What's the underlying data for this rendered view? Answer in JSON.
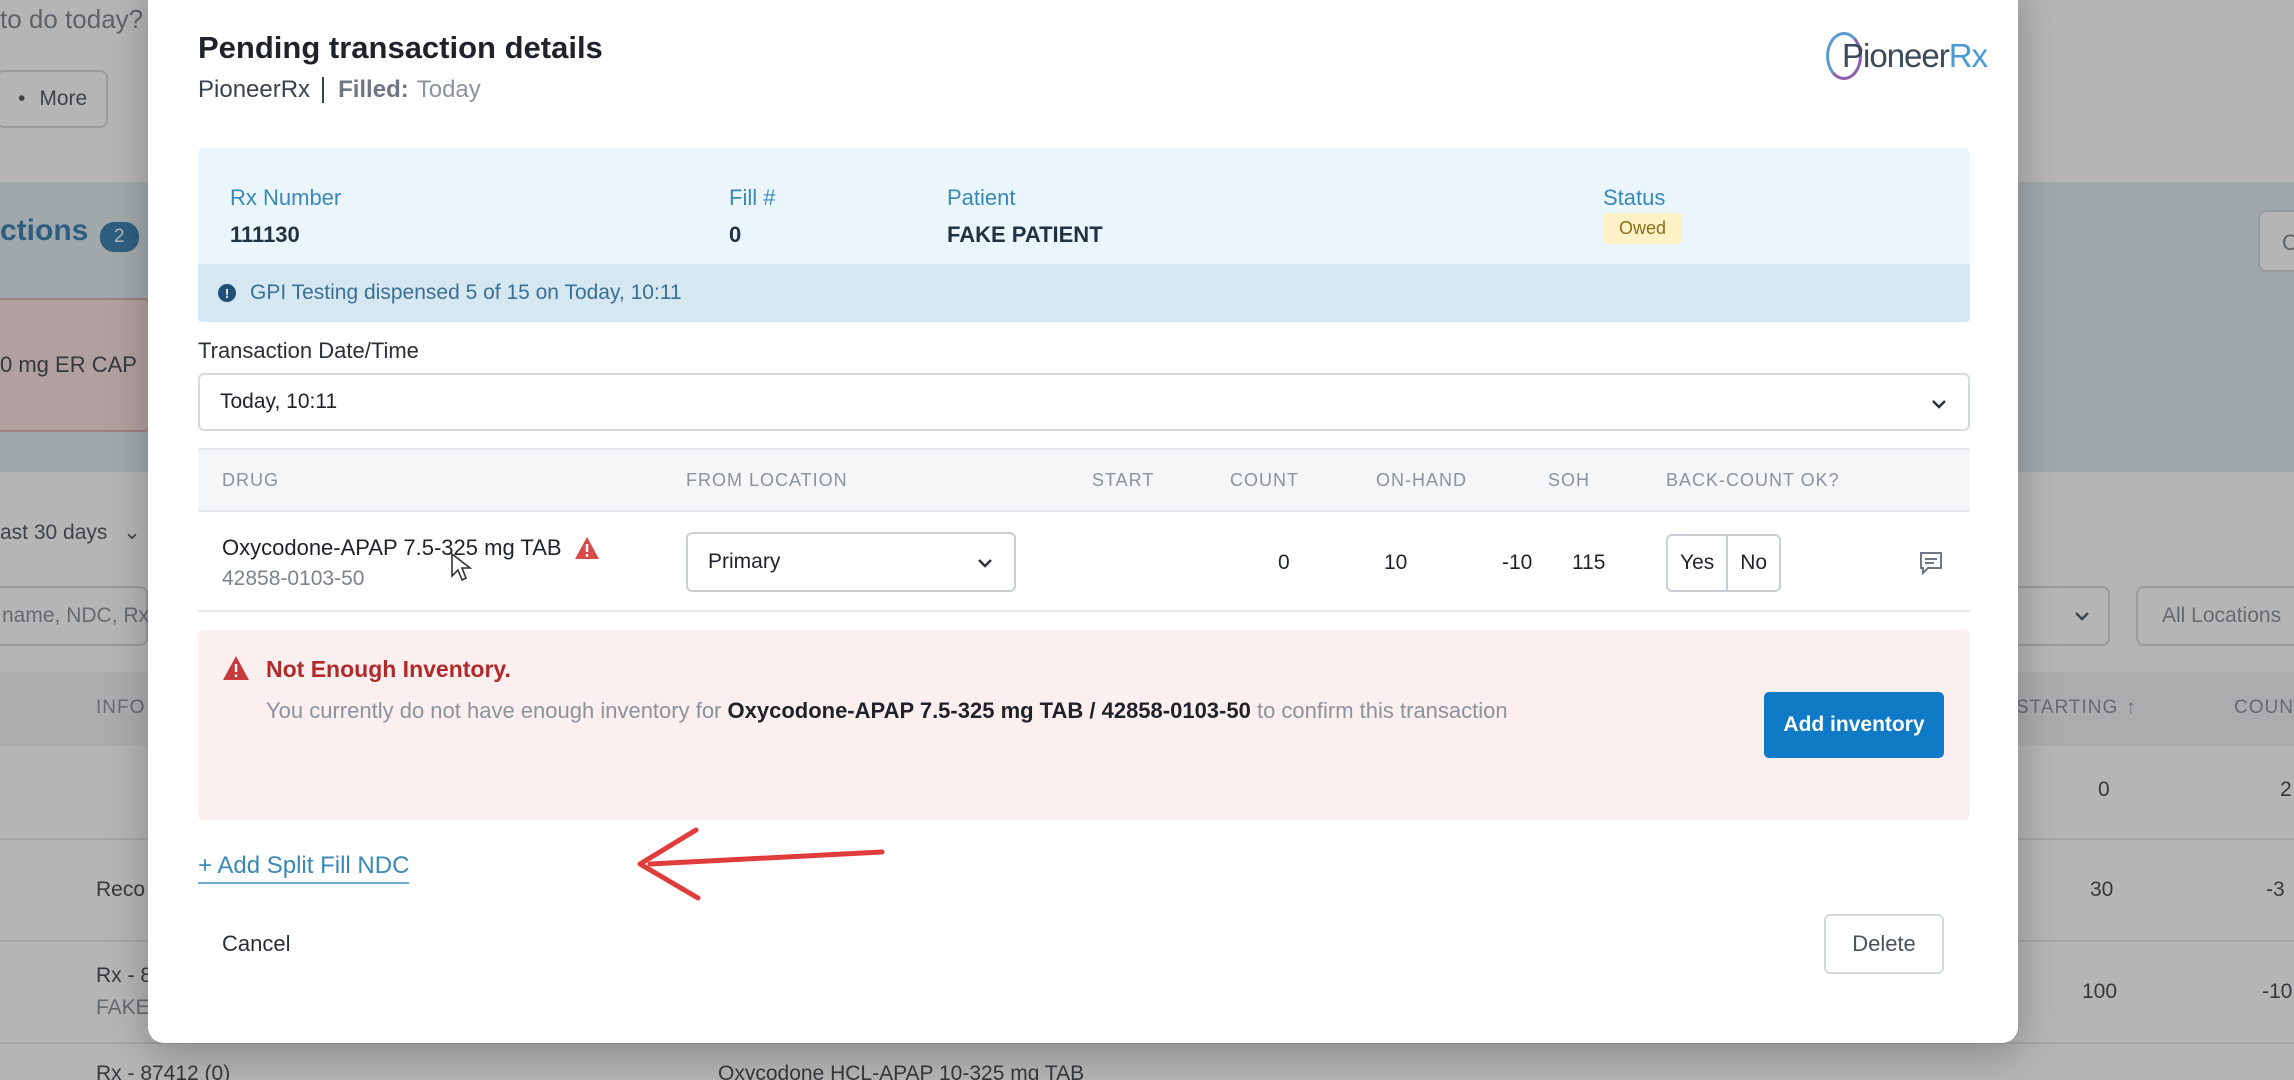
{
  "background": {
    "question_fragment": "to do today?",
    "more_button": "More",
    "section_title": "ctions",
    "section_badge": "2",
    "red_card_text": "0 mg ER CAP",
    "right_button": "C",
    "date_range": "ast 30 days",
    "search_placeholder": "name, NDC, Rx",
    "locations_select": "All Locations",
    "table_headers": {
      "info": "INFO",
      "starting": "STARTING",
      "count": "COUN"
    },
    "rows": [
      {
        "left": "",
        "starting": "0",
        "count": "2"
      },
      {
        "left": "Reco",
        "starting": "30",
        "count": "-3"
      },
      {
        "left": "Rx - 8",
        "left_sub": "FAKE",
        "starting": "100",
        "count": "-10"
      },
      {
        "left": "Rx - 87412 (0)",
        "mid": "Oxycodone HCL-APAP 10-325 mg TAB"
      }
    ]
  },
  "modal": {
    "title": "Pending transaction details",
    "subtitle_source": "PioneerRx",
    "filled_label": "Filled:",
    "filled_value": "Today",
    "logo": {
      "part1": "Pioneer",
      "part2": "Rx",
      "color_primary": "#4a9ad4",
      "color_accent": "#8e5fb0"
    },
    "info": {
      "rx_number_label": "Rx Number",
      "rx_number": "111130",
      "fill_label": "Fill #",
      "fill_value": "0",
      "patient_label": "Patient",
      "patient_value": "FAKE PATIENT",
      "status_label": "Status",
      "status_value": "Owed"
    },
    "note": "GPI Testing dispensed 5 of 15 on Today, 10:11",
    "transaction_label": "Transaction Date/Time",
    "transaction_value": "Today, 10:11",
    "table": {
      "headers": {
        "drug": "DRUG",
        "from_location": "FROM LOCATION",
        "start": "START",
        "count": "COUNT",
        "on_hand": "ON-HAND",
        "soh": "SOH",
        "back_count": "BACK-COUNT OK?"
      },
      "row": {
        "drug_name": "Oxycodone-APAP 7.5-325 mg TAB",
        "ndc": "42858-0103-50",
        "location": "Primary",
        "start": "0",
        "count": "10",
        "on_hand": "-10",
        "soh": "115",
        "yes": "Yes",
        "no": "No"
      }
    },
    "alert": {
      "title": "Not Enough Inventory.",
      "body_prefix": "You currently do not have enough inventory for ",
      "body_bold": "Oxycodone-APAP 7.5-325 mg TAB / 42858-0103-50",
      "body_suffix": " to confirm this transaction",
      "button": "Add inventory"
    },
    "split_fill_link": "+ Add Split Fill NDC",
    "cancel_button": "Cancel",
    "delete_button": "Delete"
  },
  "colors": {
    "primary_blue": "#0f7ac6",
    "alert_red": "#b02a2a",
    "arrow_red": "#e03c3c",
    "status_yellow": "#fdf2c6"
  }
}
